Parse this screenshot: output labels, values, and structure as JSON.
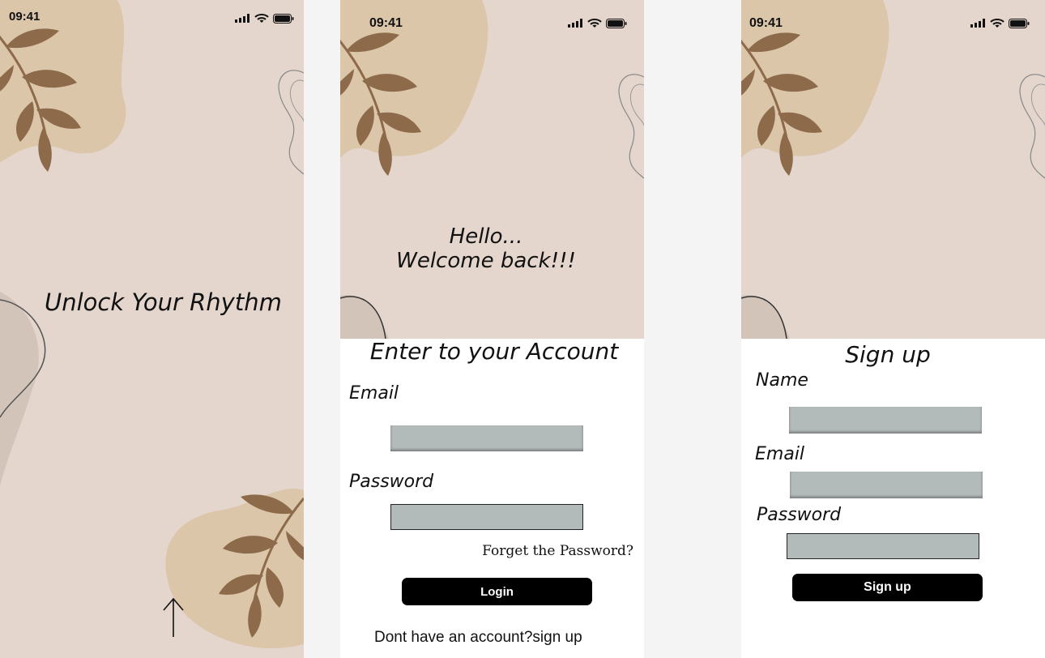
{
  "status_bar": {
    "time": "09:41"
  },
  "splash": {
    "title": "Unlock Your Rhythm"
  },
  "login": {
    "greeting_line1": "Hello...",
    "greeting_line2": "Welcome back!!!",
    "heading": "Enter to your Account",
    "email_label": "Email",
    "password_label": "Password",
    "forgot_link": "Forget the Password?",
    "login_button": "Login",
    "signup_prompt": "Dont have an account?sign up"
  },
  "signup": {
    "heading": "Sign up",
    "name_label": "Name",
    "email_label": "Email",
    "password_label": "Password",
    "signup_button": "Sign up"
  },
  "colors": {
    "bg_beige": "#e4d6cd",
    "blob_tan": "#dcc6aa",
    "leaf_brown": "#8c6a4a",
    "field_gray": "#b3baba",
    "button_black": "#000000"
  }
}
